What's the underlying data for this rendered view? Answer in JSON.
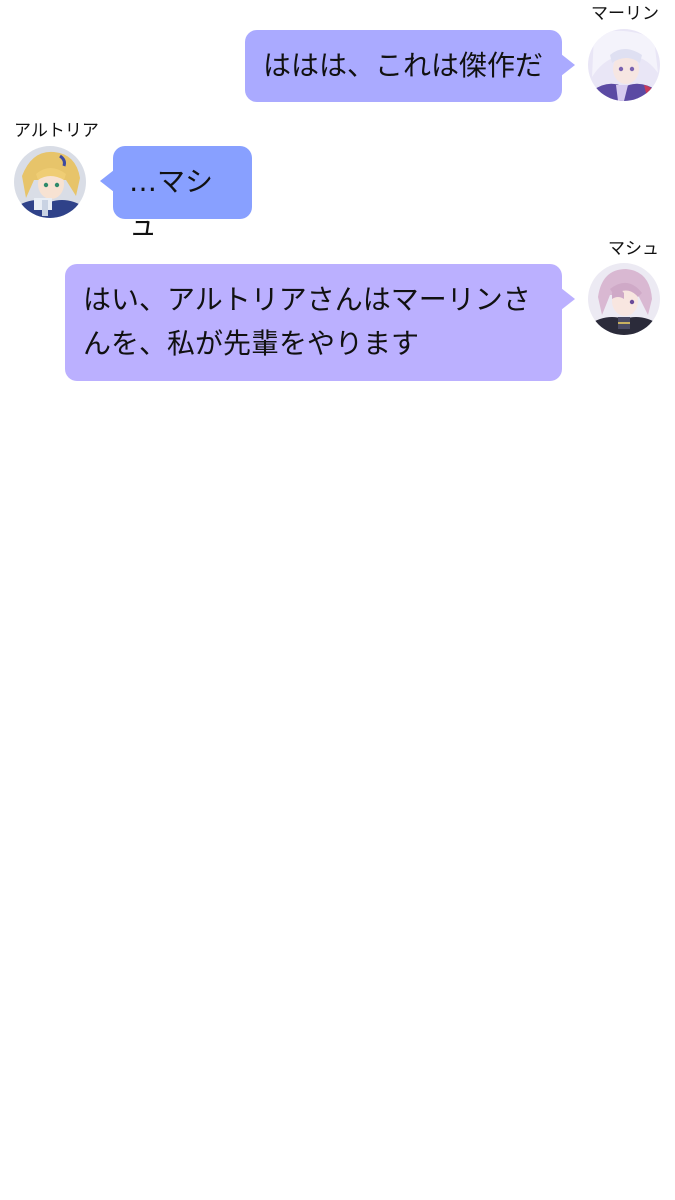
{
  "messages": [
    {
      "sender": "マーリン",
      "text": "ははは、これは傑作だ",
      "side": "right",
      "avatar_icon": "merlin-avatar-icon",
      "bubble_color": "#aaaaff"
    },
    {
      "sender": "アルトリア",
      "text": "…マシュ",
      "side": "left",
      "avatar_icon": "artoria-avatar-icon",
      "bubble_color": "#88a0ff"
    },
    {
      "sender": "マシュ",
      "text": "はい、アルトリアさんはマーリンさんを、私が先輩をやります",
      "side": "right",
      "avatar_icon": "mash-avatar-icon",
      "bubble_color": "#bbb0ff"
    }
  ]
}
